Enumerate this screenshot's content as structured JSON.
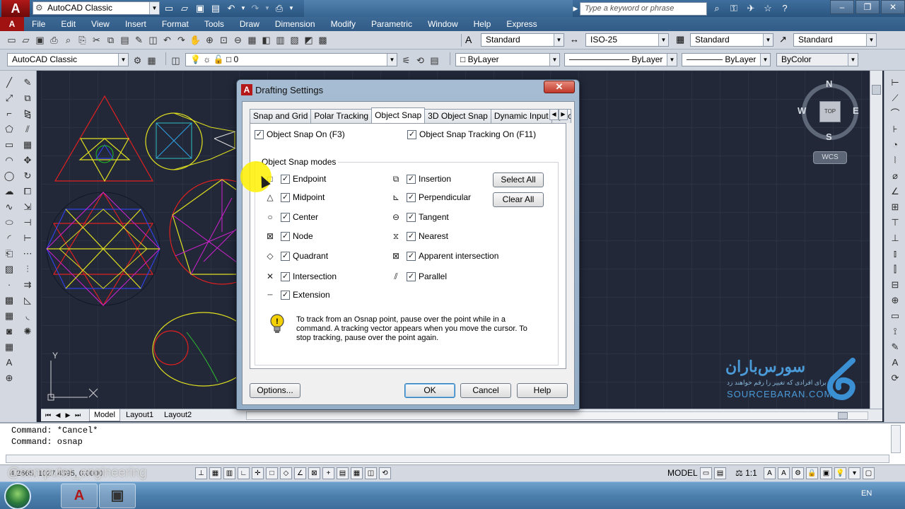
{
  "titlebar": {
    "workspace": "AutoCAD Classic",
    "search_placeholder": "Type a keyword or phrase"
  },
  "menu": [
    "File",
    "Edit",
    "View",
    "Insert",
    "Format",
    "Tools",
    "Draw",
    "Dimension",
    "Modify",
    "Parametric",
    "Window",
    "Help",
    "Express"
  ],
  "toolbar1": {
    "text_style": "Standard",
    "dim_style": "ISO-25",
    "table_style": "Standard",
    "mleader_style": "Standard"
  },
  "toolbar2": {
    "workspace": "AutoCAD Classic",
    "layer": "0",
    "color": "ByLayer",
    "linetype": "ByLayer",
    "lineweight": "ByLayer",
    "plotstyle": "ByColor"
  },
  "viewcube": {
    "north": "N",
    "south": "S",
    "east": "E",
    "west": "W",
    "top": "TOP",
    "wcs": "WCS"
  },
  "watermark": {
    "title": "سورس‌باران",
    "subtitle": "برای افرادی که تغییر را رقم خواهند زد",
    "url": "SOURCEBARAN.COM"
  },
  "ucs": {
    "y_label": "Y"
  },
  "layout_tabs": [
    "Model",
    "Layout1",
    "Layout2"
  ],
  "command": {
    "lines": [
      "Command: *Cancel*",
      "Command: osnap"
    ]
  },
  "statusbar": {
    "coords": "4.2665, 1027.4595, 0.0000",
    "model": "MODEL",
    "scale": "1:1",
    "channel": "@computer_engineering"
  },
  "taskbar": {
    "lang": "EN"
  },
  "dialog": {
    "title": "Drafting Settings",
    "close": "✕",
    "tabs": [
      "Snap and Grid",
      "Polar Tracking",
      "Object Snap",
      "3D Object Snap",
      "Dynamic Input",
      "Quic"
    ],
    "active_tab": "Object Snap",
    "osnap_on": {
      "label": "Object Snap On (F3)",
      "checked": true
    },
    "osnap_tracking": {
      "label": "Object Snap Tracking On (F11)",
      "checked": true
    },
    "group_label": "Object Snap modes",
    "left_modes": [
      {
        "label": "Endpoint",
        "glyph": "□",
        "checked": true
      },
      {
        "label": "Midpoint",
        "glyph": "△",
        "checked": true
      },
      {
        "label": "Center",
        "glyph": "○",
        "checked": true
      },
      {
        "label": "Node",
        "glyph": "⊠",
        "checked": true
      },
      {
        "label": "Quadrant",
        "glyph": "◇",
        "checked": true
      },
      {
        "label": "Intersection",
        "glyph": "✕",
        "checked": true
      },
      {
        "label": "Extension",
        "glyph": "┄",
        "checked": true
      }
    ],
    "right_modes": [
      {
        "label": "Insertion",
        "glyph": "⧉",
        "checked": true
      },
      {
        "label": "Perpendicular",
        "glyph": "⊾",
        "checked": true
      },
      {
        "label": "Tangent",
        "glyph": "⊖",
        "checked": true
      },
      {
        "label": "Nearest",
        "glyph": "⧖",
        "checked": true
      },
      {
        "label": "Apparent intersection",
        "glyph": "⊠",
        "checked": true
      },
      {
        "label": "Parallel",
        "glyph": "⫽",
        "checked": true
      }
    ],
    "select_all": "Select All",
    "clear_all": "Clear All",
    "tip": "To track from an Osnap point, pause over the point while in a command.  A tracking vector appears when you move the cursor. To stop tracking, pause over the point again.",
    "options": "Options...",
    "ok": "OK",
    "cancel": "Cancel",
    "help": "Help"
  }
}
